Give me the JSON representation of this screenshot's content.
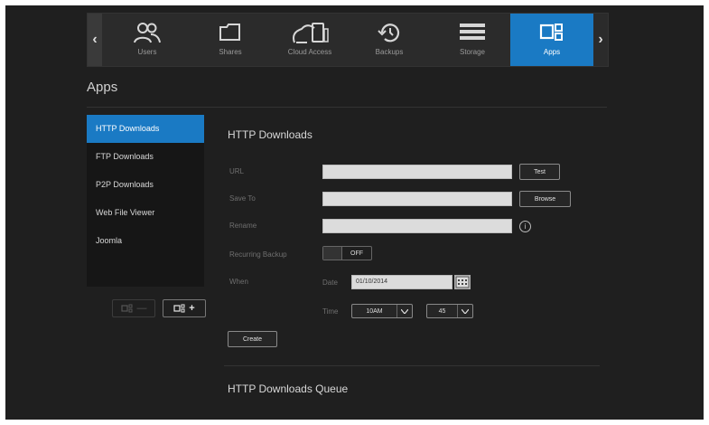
{
  "nav": {
    "items": [
      {
        "label": "Users",
        "icon": "users-icon"
      },
      {
        "label": "Shares",
        "icon": "folder-icon"
      },
      {
        "label": "Cloud Access",
        "icon": "cloud-devices-icon"
      },
      {
        "label": "Backups",
        "icon": "history-icon"
      },
      {
        "label": "Storage",
        "icon": "storage-icon"
      },
      {
        "label": "Apps",
        "icon": "apps-icon"
      }
    ],
    "active": "Apps",
    "prev": "‹",
    "next": "›"
  },
  "page": {
    "title": "Apps"
  },
  "sidebar": {
    "items": [
      {
        "label": "HTTP Downloads"
      },
      {
        "label": "FTP Downloads"
      },
      {
        "label": "P2P Downloads"
      },
      {
        "label": "Web File Viewer"
      },
      {
        "label": "Joomla"
      }
    ],
    "remove_symbol": "—",
    "add_symbol": "+"
  },
  "form": {
    "title": "HTTP Downloads",
    "url_label": "URL",
    "url_value": "",
    "test_label": "Test",
    "save_to_label": "Save To",
    "save_to_value": "",
    "browse_label": "Browse",
    "rename_label": "Rename",
    "rename_value": "",
    "info_symbol": "i",
    "recurring_label": "Recurring Backup",
    "recurring_state": "OFF",
    "when_label": "When",
    "date_label": "Date",
    "date_value": "01/10/2014",
    "time_label": "Time",
    "hour_value": "10AM",
    "minute_value": "45",
    "create_label": "Create"
  },
  "queue": {
    "title": "HTTP Downloads Queue"
  },
  "colors": {
    "accent": "#1a7ac4",
    "background": "#1f1f1f"
  }
}
